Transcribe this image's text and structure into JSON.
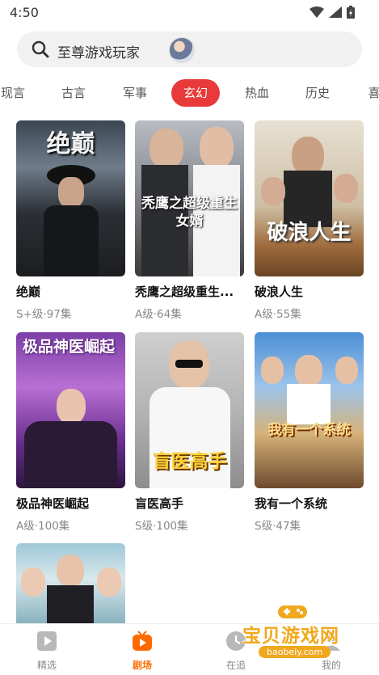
{
  "status_bar": {
    "time": "4:50"
  },
  "search": {
    "text": "至尊游戏玩家"
  },
  "tabs": [
    {
      "label": "现言"
    },
    {
      "label": "古言"
    },
    {
      "label": "军事"
    },
    {
      "label": "玄幻",
      "active": true
    },
    {
      "label": "热血"
    },
    {
      "label": "历史"
    },
    {
      "label": "喜"
    }
  ],
  "cards": [
    {
      "title": "绝巅",
      "meta": "S+级·97集",
      "poster_text": "绝巅"
    },
    {
      "title": "秃鹰之超级重生...",
      "meta": "A级·64集",
      "poster_text": "秃鹰之超级重生女婿"
    },
    {
      "title": "破浪人生",
      "meta": "A级·55集",
      "poster_text": "破浪人生"
    },
    {
      "title": "极品神医崛起",
      "meta": "A级·100集",
      "poster_text": "极品神医崛起"
    },
    {
      "title": "盲医高手",
      "meta": "S级·100集",
      "poster_text": "盲医高手"
    },
    {
      "title": "我有一个系统",
      "meta": "S级·47集",
      "poster_text": "我有一个系统"
    },
    {
      "title": "",
      "meta": "",
      "poster_text": ""
    }
  ],
  "bottom_nav": [
    {
      "label": "精选",
      "icon": "play-square-icon"
    },
    {
      "label": "剧场",
      "icon": "tv-icon",
      "active": true
    },
    {
      "label": "在追",
      "icon": "clock-icon"
    },
    {
      "label": "我的",
      "icon": "user-icon"
    }
  ],
  "watermark": {
    "text": "宝贝游戏网",
    "sub": "baobeiy.com"
  },
  "colors": {
    "accent": "#e83a3a",
    "nav_active": "#ff6a00"
  }
}
